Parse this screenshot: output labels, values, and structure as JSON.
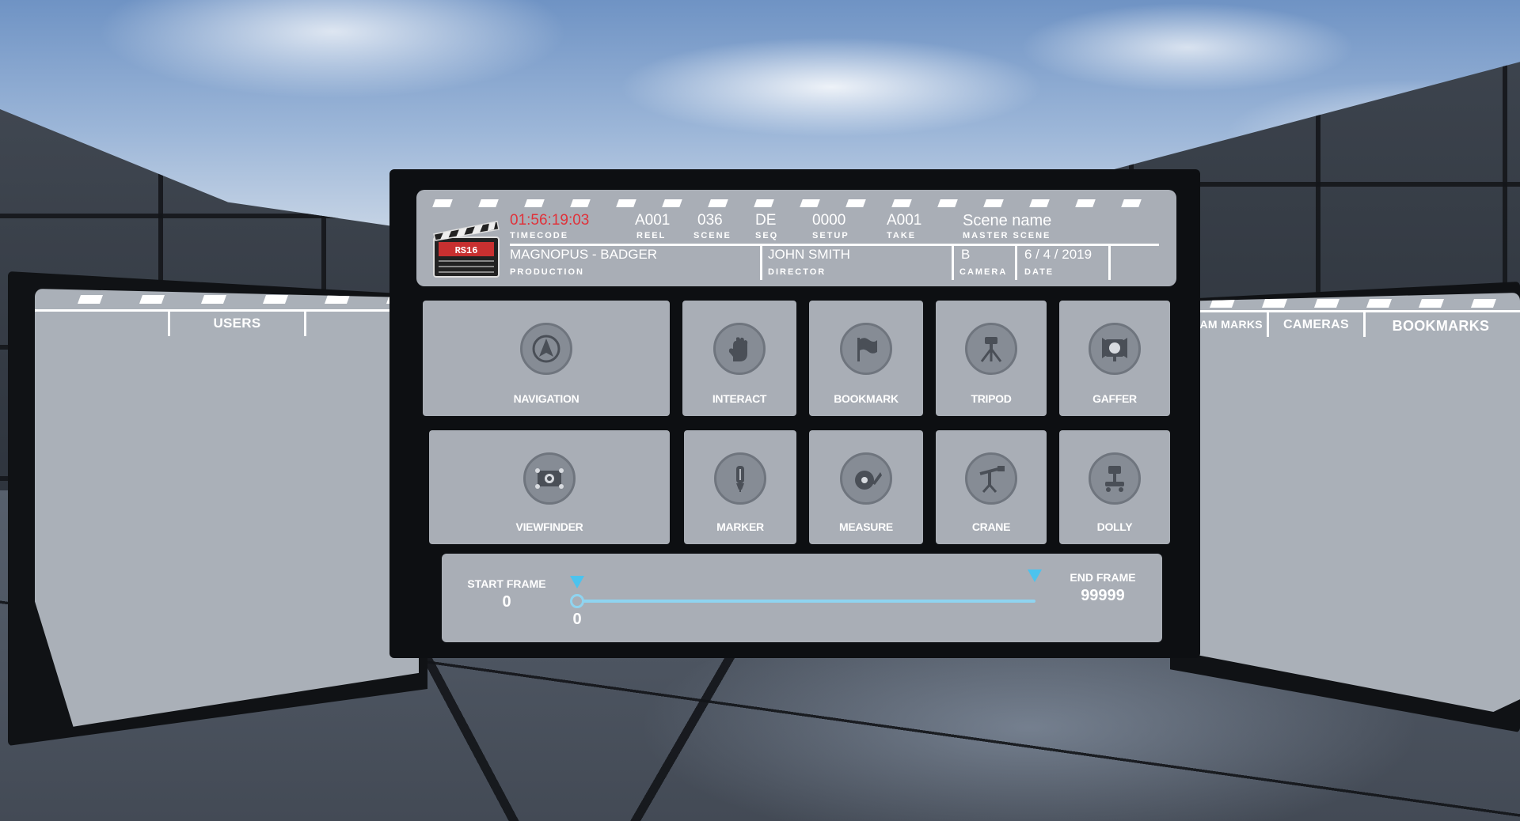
{
  "slate": {
    "timecode": "01:56:19:03",
    "timecode_label": "TIMECODE",
    "reel": "A001",
    "reel_label": "REEL",
    "scene": "036",
    "scene_label": "SCENE",
    "seq": "DE",
    "seq_label": "SEQ",
    "setup": "0000",
    "setup_label": "SETUP",
    "take": "A001",
    "take_label": "TAKE",
    "scene_name": "Scene name",
    "scene_name_label": "MASTER SCENE",
    "production": "MAGNOPUS -  BADGER",
    "production_label": "PRODUCTION",
    "director": "JOHN SMITH",
    "director_label": "DIRECTOR",
    "camera": "B",
    "camera_label": "CAMERA",
    "date": "6 / 4 / 2019",
    "date_label": "DATE"
  },
  "tools": [
    {
      "label": "NAVIGATION",
      "icon": "navigation-arrow-icon"
    },
    {
      "label": "INTERACT",
      "icon": "glove-hand-icon"
    },
    {
      "label": "BOOKMARK",
      "icon": "flag-icon"
    },
    {
      "label": "TRIPOD",
      "icon": "tripod-icon"
    },
    {
      "label": "GAFFER",
      "icon": "light-icon"
    },
    {
      "label": "VIEWFINDER",
      "icon": "viewfinder-icon"
    },
    {
      "label": "MARKER",
      "icon": "marker-pen-icon"
    },
    {
      "label": "MEASURE",
      "icon": "tape-measure-icon"
    },
    {
      "label": "CRANE",
      "icon": "crane-icon"
    },
    {
      "label": "DOLLY",
      "icon": "dolly-icon"
    }
  ],
  "timeline": {
    "start_label": "START FRAME",
    "start_value": "0",
    "current_value": "0",
    "end_label": "END FRAME",
    "end_value": "99999"
  },
  "left_panel": {
    "tab": "USERS"
  },
  "right_panel": {
    "tabs": [
      "CAM MARKS",
      "CAMERAS",
      "BOOKMARKS"
    ]
  },
  "colors": {
    "panel": "#a9aeb6",
    "frame": "#0d0f12",
    "timecode": "#e0323a",
    "accent": "#4cc3ee"
  }
}
